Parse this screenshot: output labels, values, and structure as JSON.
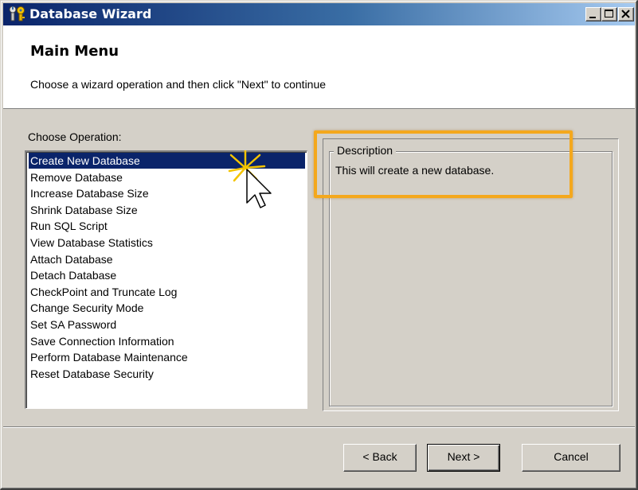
{
  "window": {
    "title": "Database Wizard",
    "controls": {
      "minimize": "minimize",
      "maximize": "maximize",
      "close": "close"
    }
  },
  "header": {
    "title": "Main Menu",
    "subtitle": "Choose a wizard operation and then click \"Next\" to continue"
  },
  "operations": {
    "label": "Choose Operation:",
    "selected_index": 0,
    "items": [
      "Create New Database",
      "Remove Database",
      "Increase Database Size",
      "Shrink Database Size",
      "Run SQL Script",
      "View Database Statistics",
      "Attach Database",
      "Detach Database",
      "CheckPoint and Truncate Log",
      "Change Security Mode",
      "Set SA Password",
      "Save Connection Information",
      "Perform Database Maintenance",
      "Reset Database Security"
    ]
  },
  "description": {
    "legend": "Description",
    "text": "This will create a new database."
  },
  "buttons": {
    "back": "< Back",
    "next": "Next >",
    "cancel": "Cancel"
  },
  "colors": {
    "title_bar": "#0a246a",
    "selection": "#0a246a",
    "highlight_box": "#f4a81d",
    "face": "#d4d0c8"
  }
}
